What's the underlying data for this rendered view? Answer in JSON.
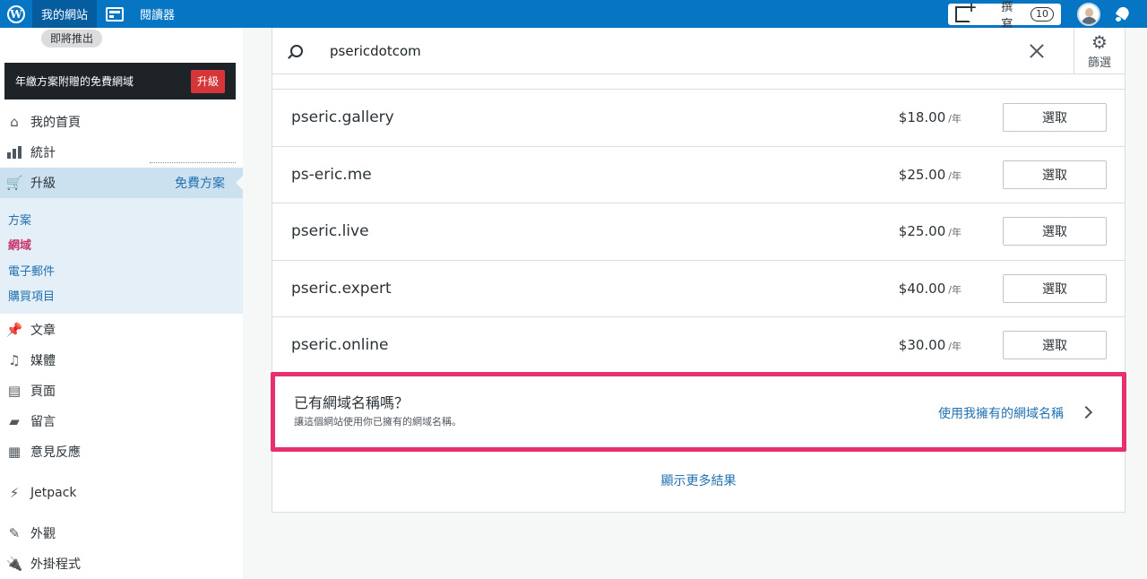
{
  "topbar": {
    "site_name": "我的網站",
    "reader_label": "閱讀器",
    "write_label": "撰寫",
    "notification_count": "10"
  },
  "sidebar": {
    "coming_soon": "即將推出",
    "upsell_text": "年繳方案附贈的免費網域",
    "upsell_button": "升級",
    "items": [
      {
        "label": "我的首頁",
        "icon": "home-icon"
      },
      {
        "label": "統計",
        "icon": "stats-icon"
      },
      {
        "label": "升級",
        "icon": "cart-icon",
        "badge": "免費方案"
      },
      {
        "label": "文章",
        "icon": "pin-icon"
      },
      {
        "label": "媒體",
        "icon": "media-icon"
      },
      {
        "label": "頁面",
        "icon": "pages-icon"
      },
      {
        "label": "留言",
        "icon": "comment-icon"
      },
      {
        "label": "意見反應",
        "icon": "feedback-icon"
      },
      {
        "label": "Jetpack",
        "icon": "jetpack-icon"
      },
      {
        "label": "外觀",
        "icon": "appearance-icon"
      },
      {
        "label": "外掛程式",
        "icon": "plugin-icon"
      }
    ],
    "submenu": [
      {
        "label": "方案"
      },
      {
        "label": "網域",
        "current": true
      },
      {
        "label": "電子郵件"
      },
      {
        "label": "購買項目"
      }
    ]
  },
  "search": {
    "value": "psericdotcom",
    "filter_label": "篩選"
  },
  "results": [
    {
      "domain": "pseric.gallery",
      "price": "$18.00",
      "per": "/年",
      "button": "選取"
    },
    {
      "domain": "ps-eric.me",
      "price": "$25.00",
      "per": "/年",
      "button": "選取"
    },
    {
      "domain": "pseric.live",
      "price": "$25.00",
      "per": "/年",
      "button": "選取"
    },
    {
      "domain": "pseric.expert",
      "price": "$40.00",
      "per": "/年",
      "button": "選取"
    },
    {
      "domain": "pseric.online",
      "price": "$30.00",
      "per": "/年",
      "button": "選取"
    }
  ],
  "own_domain": {
    "title": "已有網域名稱嗎？",
    "subtitle": "讓這個網站使用你已擁有的網域名稱。",
    "link": "使用我擁有的網域名稱"
  },
  "show_more": "顯示更多結果",
  "colors": {
    "topbar": "#0675c4",
    "accent_link": "#2271b1",
    "highlight_border": "#e8306c",
    "current_submenu": "#c9356e",
    "upsell_button": "#d63638"
  }
}
